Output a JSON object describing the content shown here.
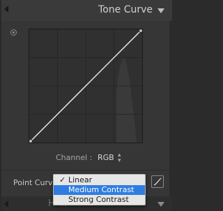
{
  "header": {
    "title": "Tone Curve"
  },
  "channel": {
    "label": "Channel :",
    "value": "RGB",
    "arrow": "⌃⌄"
  },
  "point_curve": {
    "label": "Point Curve"
  },
  "menu": {
    "items": [
      {
        "label": "Linear",
        "checked": true,
        "highlighted": false
      },
      {
        "label": "Medium Contrast",
        "checked": false,
        "highlighted": true
      },
      {
        "label": "Strong Contrast",
        "checked": false,
        "highlighted": false
      }
    ],
    "check_glyph": "✓"
  },
  "bottom_bar": {
    "ghost_text": "H              W"
  },
  "colors": {
    "highlight": "#2f7de0",
    "panel_bg": "#363636",
    "graph_bg": "#303030"
  }
}
